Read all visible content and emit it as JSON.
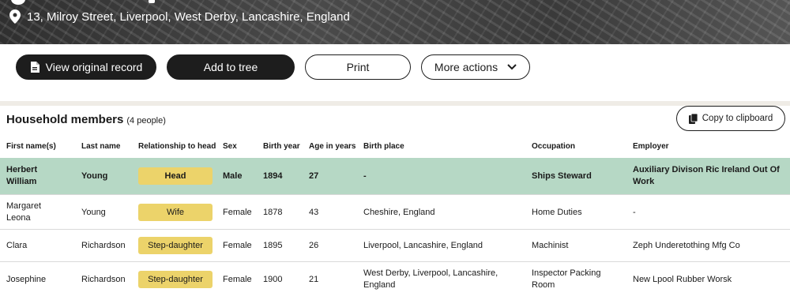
{
  "header": {
    "address": "13, Milroy Street, Liverpool, West Derby, Lancashire, England"
  },
  "toolbar": {
    "view_original": "View original record",
    "add_to_tree": "Add to tree",
    "print": "Print",
    "more_actions": "More actions"
  },
  "household": {
    "title": "Household members",
    "count": "(4 people)",
    "copy_label": "Copy to clipboard",
    "columns": {
      "first_names": "First name(s)",
      "last_name": "Last name",
      "relationship": "Relationship to head",
      "sex": "Sex",
      "birth_year": "Birth year",
      "age": "Age in years",
      "birth_place": "Birth place",
      "occupation": "Occupation",
      "employer": "Employer"
    },
    "rows": [
      {
        "first_names": "Herbert William",
        "last_name": "Young",
        "relationship": "Head",
        "sex": "Male",
        "birth_year": "1894",
        "age": "27",
        "birth_place": "-",
        "occupation": "Ships Steward",
        "employer": "Auxiliary Divison Ric Ireland Out Of Work"
      },
      {
        "first_names": "Margaret Leona",
        "last_name": "Young",
        "relationship": "Wife",
        "sex": "Female",
        "birth_year": "1878",
        "age": "43",
        "birth_place": "Cheshire, England",
        "occupation": "Home Duties",
        "employer": "-"
      },
      {
        "first_names": "Clara",
        "last_name": "Richardson",
        "relationship": "Step-daughter",
        "sex": "Female",
        "birth_year": "1895",
        "age": "26",
        "birth_place": "Liverpool, Lancashire, England",
        "occupation": "Machinist",
        "employer": "Zeph Underetothing Mfg Co"
      },
      {
        "first_names": "Josephine",
        "last_name": "Richardson",
        "relationship": "Step-daughter",
        "sex": "Female",
        "birth_year": "1900",
        "age": "21",
        "birth_place": "West Derby, Liverpool, Lancashire, England",
        "occupation": "Inspector Packing Room",
        "employer": "New Lpool Rubber Worsk"
      }
    ]
  },
  "colors": {
    "head_row": "#b6d8c5",
    "relationship_pill": "#ecd36a",
    "button_dark": "#1d1d1d",
    "band": "#efece6"
  },
  "icons": {
    "pin": "map-pin-icon",
    "document": "document-icon",
    "chevron": "chevron-down-icon",
    "clipboard": "clipboard-icon"
  }
}
